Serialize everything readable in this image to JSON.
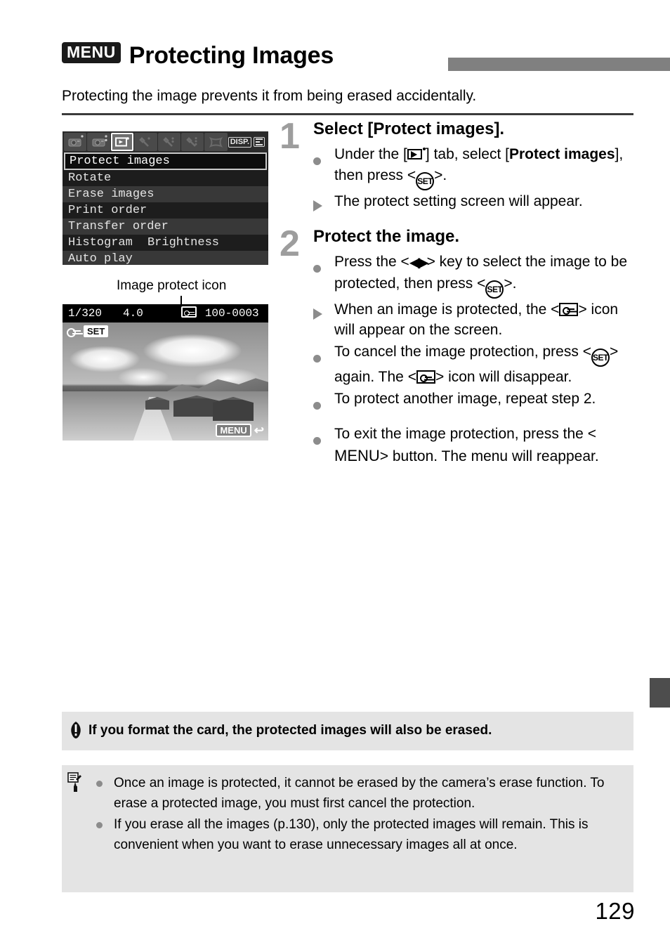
{
  "header": {
    "menu_chip": "MENU",
    "title": "Protecting Images",
    "intro": "Protecting the image prevents it from being erased accidentally."
  },
  "camera_menu": {
    "tabs": [
      {
        "name": "shooting-1",
        "selected": false
      },
      {
        "name": "shooting-2",
        "selected": false
      },
      {
        "name": "playback",
        "selected": true
      },
      {
        "name": "setup-1",
        "selected": false
      },
      {
        "name": "setup-2",
        "selected": false
      },
      {
        "name": "setup-3",
        "selected": false
      },
      {
        "name": "custom",
        "selected": false
      }
    ],
    "disp_label": "DISP.",
    "items": [
      {
        "label": "Protect images",
        "value": "",
        "highlighted": true
      },
      {
        "label": "Rotate",
        "value": "",
        "highlighted": false
      },
      {
        "label": "Erase images",
        "value": "",
        "highlighted": false
      },
      {
        "label": "Print order",
        "value": "",
        "highlighted": false
      },
      {
        "label": "Transfer order",
        "value": "",
        "highlighted": false
      },
      {
        "label": "Histogram",
        "value": "Brightness",
        "highlighted": false
      },
      {
        "label": "Auto play",
        "value": "",
        "highlighted": false
      }
    ]
  },
  "callout": {
    "label": "Image protect icon"
  },
  "playback_screen": {
    "shutter_speed": "1/320",
    "aperture": "4.0",
    "file_number": "100-0003",
    "set_badge": "SET",
    "menu_badge": "MENU",
    "return_arrow": "↩"
  },
  "steps": [
    {
      "number": "1",
      "title": "Select [Protect images].",
      "bullets": [
        {
          "marker": "dot",
          "segments": [
            {
              "t": "text",
              "v": "Under the ["
            },
            {
              "t": "icon",
              "v": "playback-tab-icon"
            },
            {
              "t": "text",
              "v": "] tab, select ["
            },
            {
              "t": "bold",
              "v": "Protect images"
            },
            {
              "t": "text",
              "v": "], then press <"
            },
            {
              "t": "icon",
              "v": "set-icon"
            },
            {
              "t": "text",
              "v": ">."
            }
          ],
          "plain": "Under the [playback] tab, select [Protect images], then press <SET>."
        },
        {
          "marker": "triangle",
          "plain": "The protect setting screen will appear."
        }
      ]
    },
    {
      "number": "2",
      "title": "Protect the image.",
      "bullets": [
        {
          "marker": "dot",
          "plain": "Press the <◀▶> key to select the image to be protected, then press <SET>."
        },
        {
          "marker": "triangle",
          "plain": "When an image is protected, the <protect> icon will appear on the screen."
        },
        {
          "marker": "dot",
          "plain": "To cancel the image protection, press <SET> again. The <protect> icon will disappear."
        },
        {
          "marker": "dot",
          "plain": "To protect another image, repeat step 2."
        },
        {
          "marker": "dot",
          "plain": "To exit the image protection, press the <MENU> button. The menu will reappear."
        }
      ]
    }
  ],
  "step_text": {
    "s1_b1_p1": "Under the [",
    "s1_b1_p2": "] tab, select [",
    "s1_b1_bold": "Protect images",
    "s1_b1_p3": "], then press <",
    "s1_b1_p4": ">.",
    "s1_b2": "The protect setting screen will appear.",
    "s2_b1_p1": "Press the <",
    "s2_b1_arrows": "◀▶",
    "s2_b1_p2": "> key to select the image to be protected, then press <",
    "s2_b1_p3": ">.",
    "s2_b2_p1": "When an image is protected, the <",
    "s2_b2_p2": "> icon will appear on the screen.",
    "s2_b3_p1": "To cancel the image protection, press <",
    "s2_b3_p2": "> again. The <",
    "s2_b3_p3": "> icon will disappear.",
    "s2_b4": "To protect another image, repeat step 2.",
    "s2_b5_p1": "To exit the image protection, press the <",
    "s2_b5_menu": "MENU",
    "s2_b5_p2": "> button. The menu will reappear."
  },
  "set_icon_label": "SET",
  "caution": {
    "text": "If you format the card, the protected images will also be erased."
  },
  "note": {
    "items": [
      "Once an image is protected, it cannot be erased by the camera’s erase function. To erase a protected image, you must first cancel the protection.",
      "If you erase all the images (p.130), only the protected images will remain. This is convenient when you want to erase unnecessary images all at once."
    ]
  },
  "page_number": "129",
  "colors": {
    "header_bar": "#808080",
    "box_bg": "#e4e4e4",
    "marker_gray": "#8c8c8c",
    "step_number": "#9d9d9d",
    "side_tab": "#4d4d4d"
  }
}
